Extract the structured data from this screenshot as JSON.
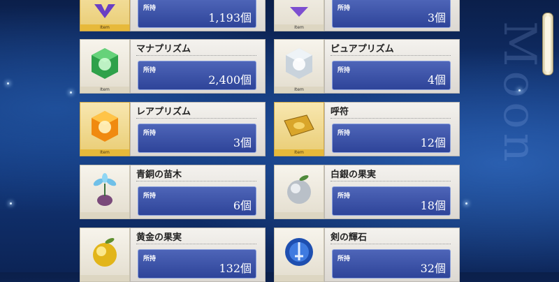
{
  "background_text": "Moon",
  "held_label": "所持",
  "items": [
    {
      "name": "",
      "qty": "1,193個",
      "icon": "purple-gem-icon",
      "tag": "Item",
      "rarity": "gold"
    },
    {
      "name": "",
      "qty": "3個",
      "icon": "purple-crystal-icon",
      "tag": "Item",
      "rarity": "silver"
    },
    {
      "name": "マナプリズム",
      "qty": "2,400個",
      "icon": "green-cube-icon",
      "tag": "Item",
      "rarity": "silver"
    },
    {
      "name": "ピュアプリズム",
      "qty": "4個",
      "icon": "white-cube-icon",
      "tag": "Item",
      "rarity": "silver"
    },
    {
      "name": "レアプリズム",
      "qty": "3個",
      "icon": "orange-cube-icon",
      "tag": "Item",
      "rarity": "gold"
    },
    {
      "name": "呼符",
      "qty": "12個",
      "icon": "gold-ticket-icon",
      "tag": "Item",
      "rarity": "gold"
    },
    {
      "name": "青銅の苗木",
      "qty": "6個",
      "icon": "bronze-sapling-icon",
      "tag": "",
      "rarity": "silver"
    },
    {
      "name": "白銀の果実",
      "qty": "18個",
      "icon": "silver-apple-icon",
      "tag": "",
      "rarity": "silver"
    },
    {
      "name": "黄金の果実",
      "qty": "132個",
      "icon": "golden-apple-icon",
      "tag": "",
      "rarity": "silver"
    },
    {
      "name": "剣の輝石",
      "qty": "32個",
      "icon": "saber-gem-icon",
      "tag": "",
      "rarity": "silver"
    }
  ]
}
